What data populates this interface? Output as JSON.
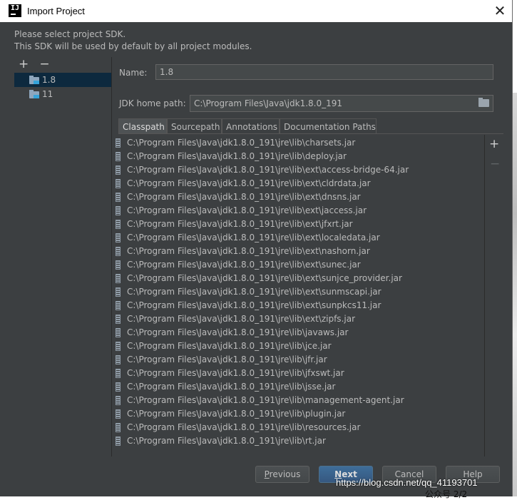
{
  "window": {
    "title": "Import Project",
    "close_glyph": "✕"
  },
  "info": {
    "line1": "Please select project SDK.",
    "line2": "This SDK will be used by default by all project modules."
  },
  "sdk_toolbar": {
    "add": "+",
    "remove": "−"
  },
  "sdks": [
    {
      "label": "1.8",
      "selected": true
    },
    {
      "label": "11",
      "selected": false
    }
  ],
  "form": {
    "name_label": "Name:",
    "name_value": "1.8",
    "jdk_label": "JDK home path:",
    "jdk_value": "C:\\Program Files\\Java\\jdk1.8.0_191"
  },
  "tabs": [
    "Classpath",
    "Sourcepath",
    "Annotations",
    "Documentation Paths"
  ],
  "active_tab": "Classpath",
  "classpath": [
    "C:\\Program Files\\Java\\jdk1.8.0_191\\jre\\lib\\charsets.jar",
    "C:\\Program Files\\Java\\jdk1.8.0_191\\jre\\lib\\deploy.jar",
    "C:\\Program Files\\Java\\jdk1.8.0_191\\jre\\lib\\ext\\access-bridge-64.jar",
    "C:\\Program Files\\Java\\jdk1.8.0_191\\jre\\lib\\ext\\cldrdata.jar",
    "C:\\Program Files\\Java\\jdk1.8.0_191\\jre\\lib\\ext\\dnsns.jar",
    "C:\\Program Files\\Java\\jdk1.8.0_191\\jre\\lib\\ext\\jaccess.jar",
    "C:\\Program Files\\Java\\jdk1.8.0_191\\jre\\lib\\ext\\jfxrt.jar",
    "C:\\Program Files\\Java\\jdk1.8.0_191\\jre\\lib\\ext\\localedata.jar",
    "C:\\Program Files\\Java\\jdk1.8.0_191\\jre\\lib\\ext\\nashorn.jar",
    "C:\\Program Files\\Java\\jdk1.8.0_191\\jre\\lib\\ext\\sunec.jar",
    "C:\\Program Files\\Java\\jdk1.8.0_191\\jre\\lib\\ext\\sunjce_provider.jar",
    "C:\\Program Files\\Java\\jdk1.8.0_191\\jre\\lib\\ext\\sunmscapi.jar",
    "C:\\Program Files\\Java\\jdk1.8.0_191\\jre\\lib\\ext\\sunpkcs11.jar",
    "C:\\Program Files\\Java\\jdk1.8.0_191\\jre\\lib\\ext\\zipfs.jar",
    "C:\\Program Files\\Java\\jdk1.8.0_191\\jre\\lib\\javaws.jar",
    "C:\\Program Files\\Java\\jdk1.8.0_191\\jre\\lib\\jce.jar",
    "C:\\Program Files\\Java\\jdk1.8.0_191\\jre\\lib\\jfr.jar",
    "C:\\Program Files\\Java\\jdk1.8.0_191\\jre\\lib\\jfxswt.jar",
    "C:\\Program Files\\Java\\jdk1.8.0_191\\jre\\lib\\jsse.jar",
    "C:\\Program Files\\Java\\jdk1.8.0_191\\jre\\lib\\management-agent.jar",
    "C:\\Program Files\\Java\\jdk1.8.0_191\\jre\\lib\\plugin.jar",
    "C:\\Program Files\\Java\\jdk1.8.0_191\\jre\\lib\\resources.jar",
    "C:\\Program Files\\Java\\jdk1.8.0_191\\jre\\lib\\rt.jar"
  ],
  "path_toolbar": {
    "add": "+",
    "remove": "−"
  },
  "buttons": {
    "previous_mnemonic": "P",
    "previous_rest": "revious",
    "next_mnemonic": "N",
    "next_rest": "ext",
    "cancel": "Cancel",
    "help": "Help"
  },
  "overlay": {
    "watermark": "https://blog.csdn.net/qq_41193701",
    "bottom_text": "公众号 2/2"
  },
  "colors": {
    "bg": "#3c3f41",
    "selection": "#0d293e",
    "accent": "#365880"
  }
}
